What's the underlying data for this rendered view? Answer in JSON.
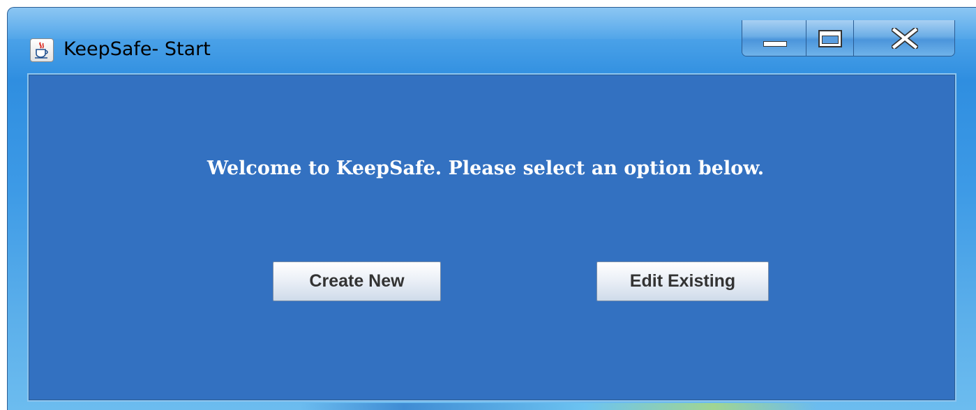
{
  "window": {
    "title": "KeepSafe- Start",
    "icon": "java-cup-icon",
    "controls": {
      "minimize_icon": "minimize-icon",
      "maximize_icon": "maximize-icon",
      "close_icon": "close-icon"
    }
  },
  "main": {
    "welcome_text": "Welcome to KeepSafe. Please select an option below.",
    "buttons": {
      "create_label": "Create New",
      "edit_label": "Edit Existing"
    }
  },
  "colors": {
    "panel_background": "#3371c1",
    "title_bar": "#3d9ae6",
    "button_text": "#333333"
  }
}
